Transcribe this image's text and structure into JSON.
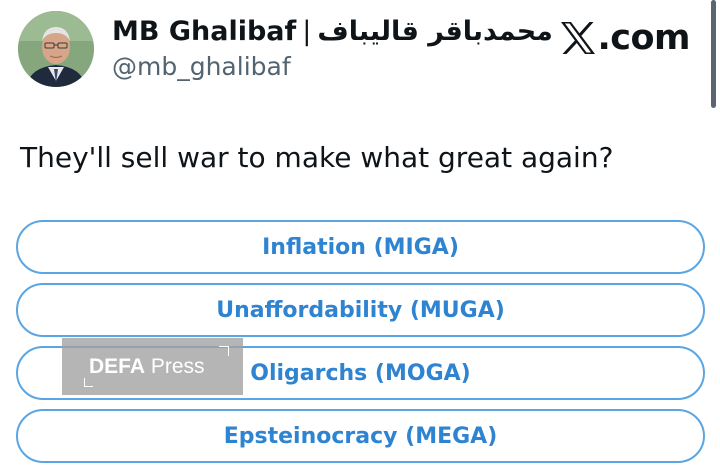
{
  "profile": {
    "display_name": "MB Ghalibaf",
    "separator": "|",
    "display_name_fa": "محمدباقر قالیباف",
    "handle": "@mb_ghalibaf"
  },
  "source": {
    "site_label": ".com",
    "logo_icon": "x-logo-icon"
  },
  "tweet": {
    "text": "They'll sell war to make what great again?"
  },
  "poll": {
    "options": [
      {
        "label": "Inflation (MIGA)"
      },
      {
        "label": "Unaffordability (MUGA)"
      },
      {
        "label": "Oligarchs (MOGA)"
      },
      {
        "label": "Epsteinocracy (MEGA)"
      }
    ]
  },
  "watermark": {
    "text": "DEFA Press"
  },
  "colors": {
    "poll_border": "#5aa5e3",
    "poll_text": "#2e84d1",
    "handle_text": "#536471",
    "primary_text": "#0f1419"
  }
}
